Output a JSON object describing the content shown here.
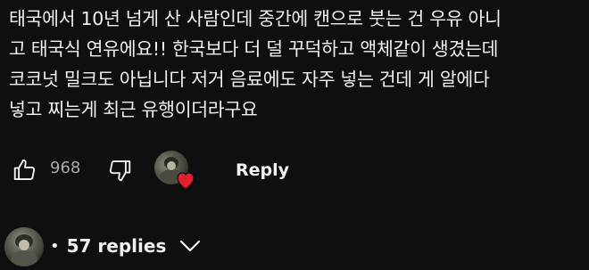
{
  "comment": {
    "text": "태국에서 10년 넘게 산 사람인데 중간에 캔으로 붓는 건 우유 아니\n고 태국식 연유에요!! 한국보다 더 덜 꾸덕하고 액체같이 생겼는데\n코코넛 밀크도 아닙니다 저거 음료에도 자주 넣는 건데 게 알에다\n넣고 찌는게 최근 유행이더라구요"
  },
  "actions": {
    "like_icon": "thumbs-up-icon",
    "like_count": "968",
    "dislike_icon": "thumbs-down-icon",
    "creator_heart_icon": "heart-icon",
    "reply_label": "Reply",
    "heart_color": "#e0202a"
  },
  "replies": {
    "dot": "•",
    "label": "57 replies",
    "toggle_icon": "chevron-down-icon"
  }
}
